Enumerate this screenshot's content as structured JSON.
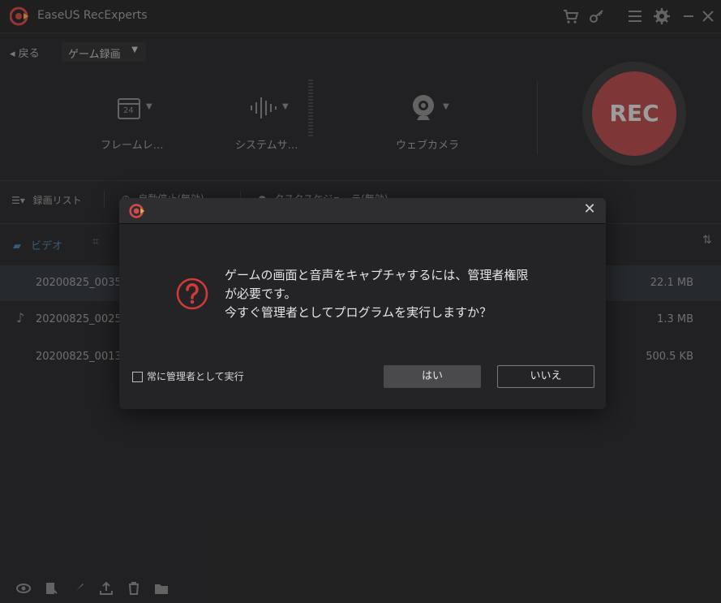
{
  "app": {
    "title": "EaseUS RecExperts",
    "logo_color": "#e04848"
  },
  "toolbar_icons": [
    "cart-icon",
    "key-icon",
    "menu-icon",
    "settings-icon",
    "minimize-icon",
    "close-icon"
  ],
  "nav": {
    "back_label": "戻る",
    "mode_label": "ゲーム録画"
  },
  "tools": {
    "frame_label": "フレームレ…",
    "frame_badge": "24",
    "system_label": "システムサ…",
    "webcam_label": "ウェブカメラ"
  },
  "rec": {
    "label": "REC",
    "color": "#b04c4c"
  },
  "list": {
    "header": {
      "list_label": "録画リスト",
      "obscured_1": "自動停止(無効)",
      "obscured_2": "タスクスケジューラ(無効)"
    },
    "video_tab": "ビデオ",
    "rows": [
      {
        "name": "20200825_0035",
        "size": "22.1 MB"
      },
      {
        "name": "20200825_0025",
        "size": "1.3 MB"
      },
      {
        "name": "20200825_0013",
        "size": "500.5 KB"
      }
    ]
  },
  "dialog": {
    "message_lines": [
      "ゲームの画面と音声をキャプチャするには、管理者権限",
      "が必要です。",
      "今すぐ管理者としてプログラムを実行しますか？"
    ],
    "checkbox_label": "常に管理者として実行",
    "checkbox_checked": false,
    "yes_label": "はい",
    "no_label": "いいえ",
    "question_icon_color": "#d23a3a"
  }
}
